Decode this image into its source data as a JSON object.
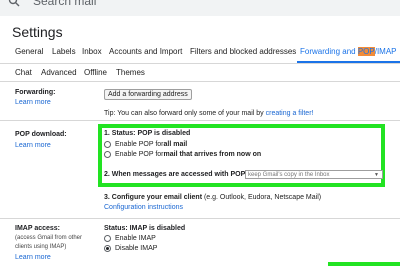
{
  "search": {
    "placeholder": "Search mail"
  },
  "page": {
    "title": "Settings"
  },
  "tabs_row1": [
    {
      "label": "General"
    },
    {
      "label": "Labels"
    },
    {
      "label": "Inbox"
    },
    {
      "label": "Accounts and Import"
    },
    {
      "label": "Filters and blocked addresses"
    },
    {
      "label_pre": "Forwarding and ",
      "label_highlight": "POP",
      "label_post": "/IMAP",
      "active": true
    }
  ],
  "tabs_row2": [
    {
      "label": "Chat"
    },
    {
      "label": "Advanced"
    },
    {
      "label": "Offline"
    },
    {
      "label": "Themes"
    }
  ],
  "forwarding": {
    "heading": "Forwarding:",
    "learn_more": "Learn more",
    "add_button": "Add a forwarding address",
    "tip_text": "Tip: You can also forward only some of your mail by ",
    "tip_link": "creating a filter!"
  },
  "pop": {
    "heading": "POP download:",
    "learn_more": "Learn more",
    "status_label": "1. Status: POP is disabled",
    "option_all_pre": "Enable POP for ",
    "option_all_bold": "all mail",
    "option_now_pre": "Enable POP for ",
    "option_now_bold": "mail that arrives from now on",
    "access_label": "2. When messages are accessed with POP",
    "access_select": "keep Gmail's copy in the Inbox",
    "configure_label": "3. Configure your email client",
    "configure_hint": " (e.g. Outlook, Eudora, Netscape Mail)",
    "configure_link": "Configuration instructions"
  },
  "imap": {
    "heading": "IMAP access:",
    "sub1": "(access Gmail from other",
    "sub2": "clients using IMAP)",
    "learn_more": "Learn more",
    "status_label": "Status: IMAP is disabled",
    "option_enable": "Enable IMAP",
    "option_disable": "Disable IMAP"
  },
  "colors": {
    "highlight_box": "#22e322",
    "active_tab": "#1a73e8",
    "pop_highlight": "#f28c38",
    "link": "#1a67d2"
  }
}
